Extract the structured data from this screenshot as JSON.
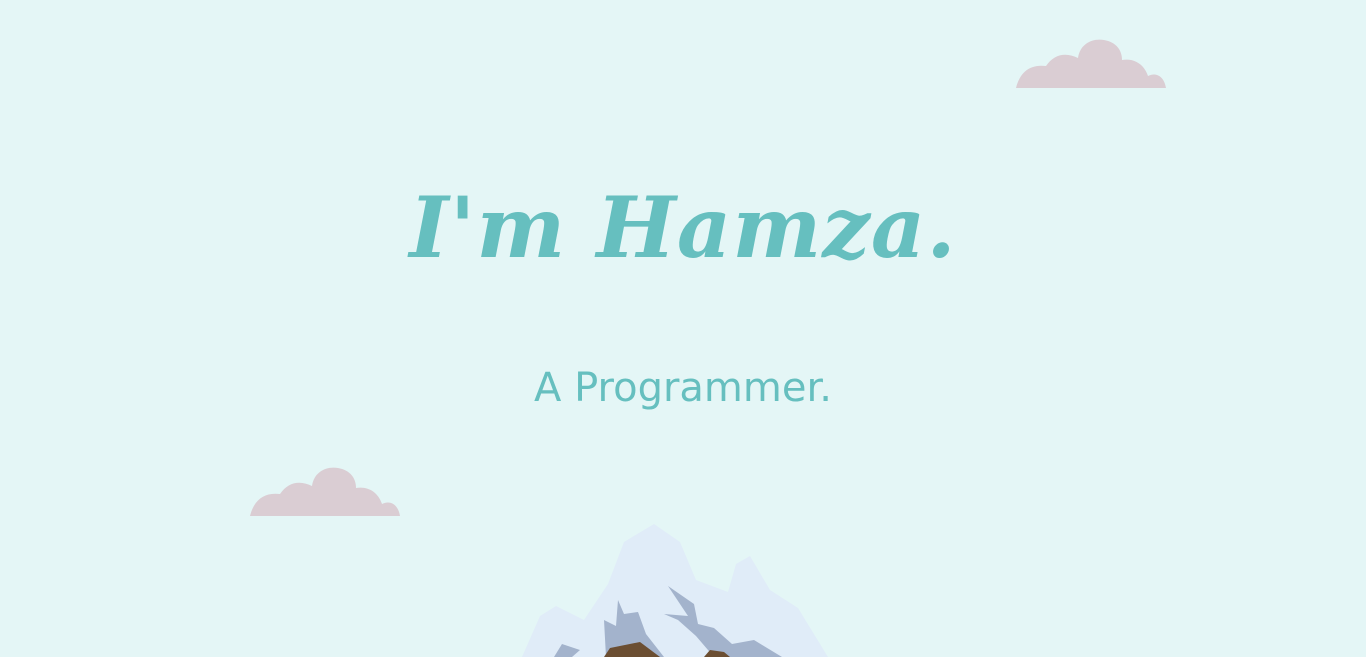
{
  "hero": {
    "title": "I'm Hamza.",
    "subtitle": "A Programmer."
  },
  "decorations": {
    "clouds": [
      "cloud-icon",
      "cloud-icon"
    ],
    "mountain": "mountain-illustration"
  },
  "colors": {
    "background": "#e4f6f6",
    "accent": "#66bfbf",
    "cloud": "#dacdd3",
    "snow": "#e0ecf8",
    "rock": "#a3b3cc",
    "earth": "#6b4e32"
  }
}
